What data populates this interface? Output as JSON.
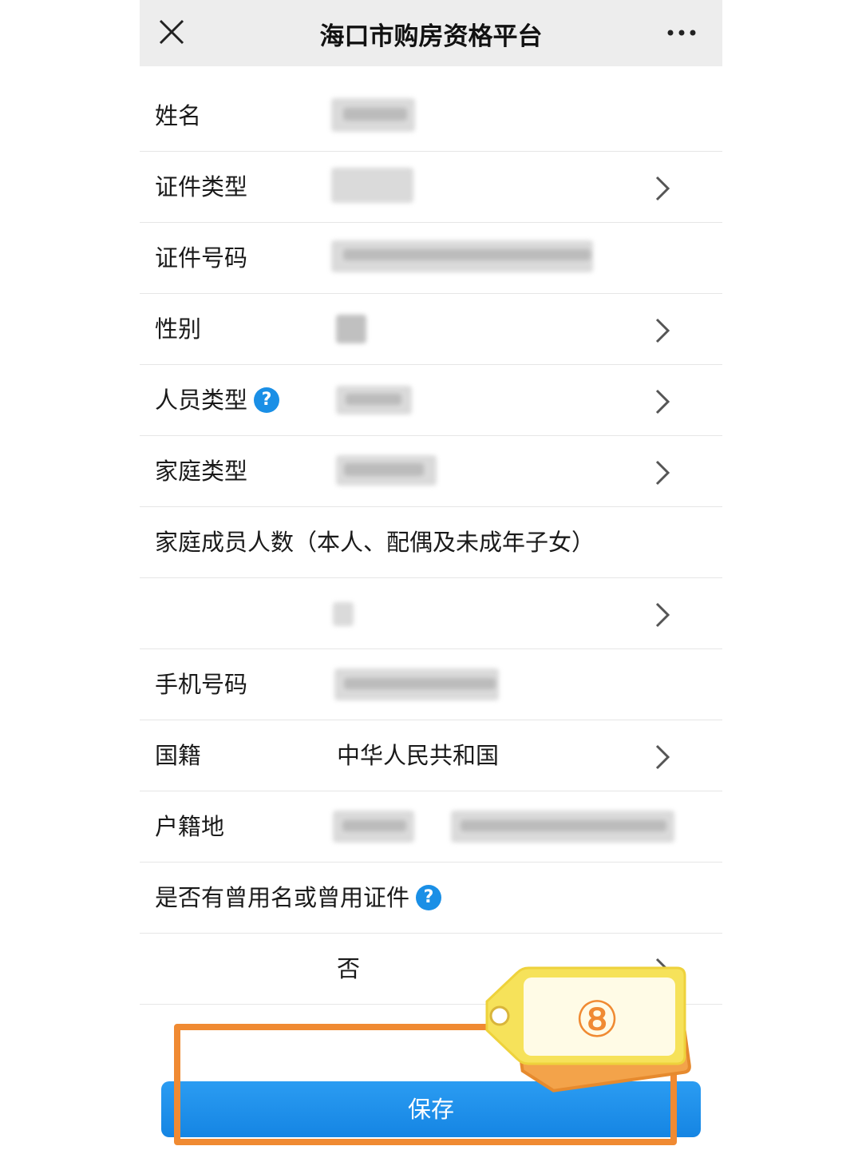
{
  "header": {
    "title": "海口市购房资格平台",
    "close_icon": "close-icon",
    "more_icon": "more-icon"
  },
  "form": {
    "name_label": "姓名",
    "id_type_label": "证件类型",
    "id_number_label": "证件号码",
    "gender_label": "性别",
    "person_type_label": "人员类型",
    "family_type_label": "家庭类型",
    "family_count_label": "家庭成员人数（本人、配偶及未成年子女）",
    "phone_label": "手机号码",
    "nationality_label": "国籍",
    "nationality_value": "中华人民共和国",
    "household_label": "户籍地",
    "former_name_label": "是否有曾用名或曾用证件",
    "former_name_value": "否",
    "help_glyph": "?"
  },
  "actions": {
    "save_label": "保存"
  },
  "annotation": {
    "step_number": "⑧",
    "highlight_color": "#f08a32"
  },
  "colors": {
    "accent": "#1a8fe6",
    "header_bg": "#ededed"
  }
}
